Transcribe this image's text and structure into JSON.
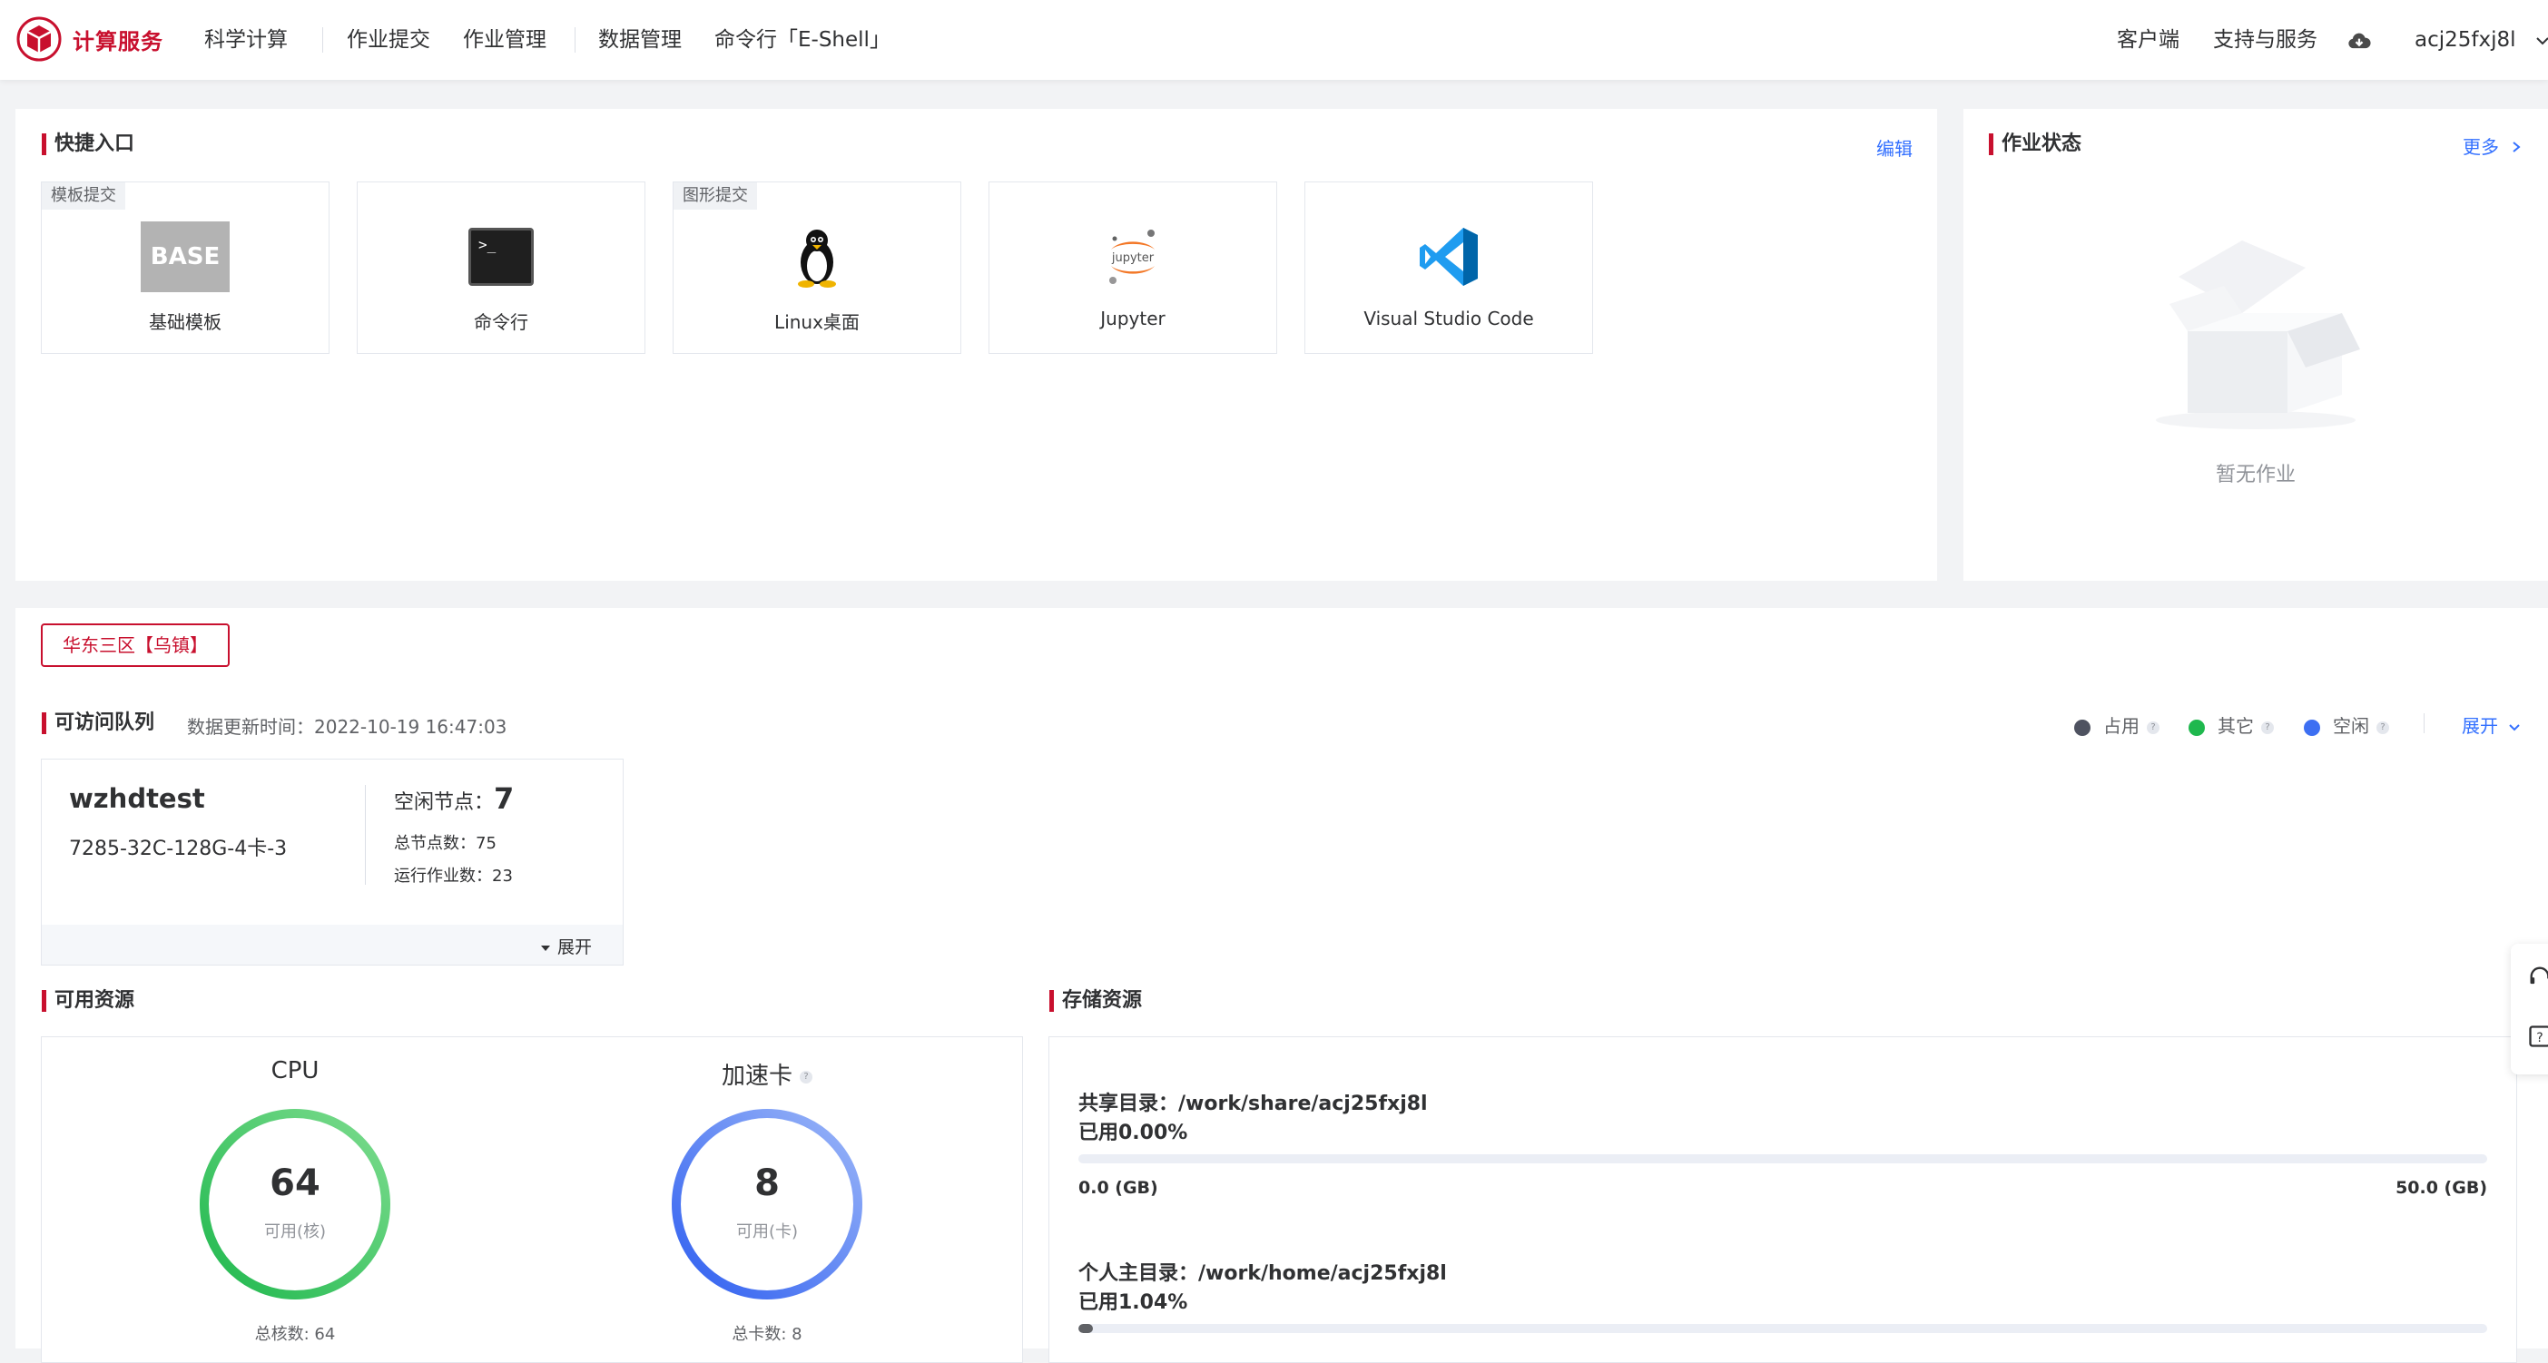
{
  "nav": {
    "brand": "计算服务",
    "items": [
      "科学计算",
      "作业提交",
      "作业管理",
      "数据管理",
      "命令行「E-Shell」"
    ],
    "client": "客户端",
    "support": "支持与服务",
    "user": "acj25fxj8l"
  },
  "quick": {
    "title": "快捷入口",
    "edit": "编辑",
    "cards": [
      {
        "tag": "模板提交",
        "label": "基础模板",
        "icon": "base-template-icon",
        "badge": "BASE"
      },
      {
        "tag": "",
        "label": "命令行",
        "icon": "terminal-icon",
        "badge": ">_"
      },
      {
        "tag": "图形提交",
        "label": "Linux桌面",
        "icon": "linux-penguin-icon"
      },
      {
        "tag": "",
        "label": "Jupyter",
        "icon": "jupyter-icon",
        "badge": "jupyter"
      },
      {
        "tag": "",
        "label": "Visual Studio Code",
        "icon": "vscode-icon"
      }
    ]
  },
  "job_status": {
    "title": "作业状态",
    "more": "更多",
    "empty": "暂无作业"
  },
  "queue": {
    "region": "华东三区【乌镇】",
    "title": "可访问队列",
    "updated": "数据更新时间：2022-10-19 16:47:03",
    "legend": [
      {
        "label": "占用",
        "color": "#4e5260"
      },
      {
        "label": "其它",
        "color": "#1fb84e"
      },
      {
        "label": "空闲",
        "color": "#3d6ff2"
      }
    ],
    "expand": "展开",
    "card": {
      "name": "wzhdtest",
      "spec": "7285-32C-128G-4卡-3",
      "idle_label": "空闲节点：",
      "idle_value": "7",
      "total_nodes": "总节点数：75",
      "running_jobs": "运行作业数：23",
      "expand": "展开"
    }
  },
  "resources": {
    "title": "可用资源",
    "cpu": {
      "label": "CPU",
      "value": "64",
      "unit": "可用(核)",
      "total": "总核数: 64",
      "fraction": 1.0
    },
    "acc": {
      "label": "加速卡",
      "value": "8",
      "unit": "可用(卡)",
      "total": "总卡数: 8",
      "fraction": 1.0
    }
  },
  "storage": {
    "title": "存储资源",
    "items": [
      {
        "name": "共享目录：/work/share/acj25fxj8l",
        "used": "已用0.00%",
        "percent": 0.0,
        "min": "0.0 (GB)",
        "max": "50.0 (GB)"
      },
      {
        "name": "个人主目录：/work/home/acj25fxj8l",
        "used": "已用1.04%",
        "percent": 1.04
      }
    ]
  }
}
